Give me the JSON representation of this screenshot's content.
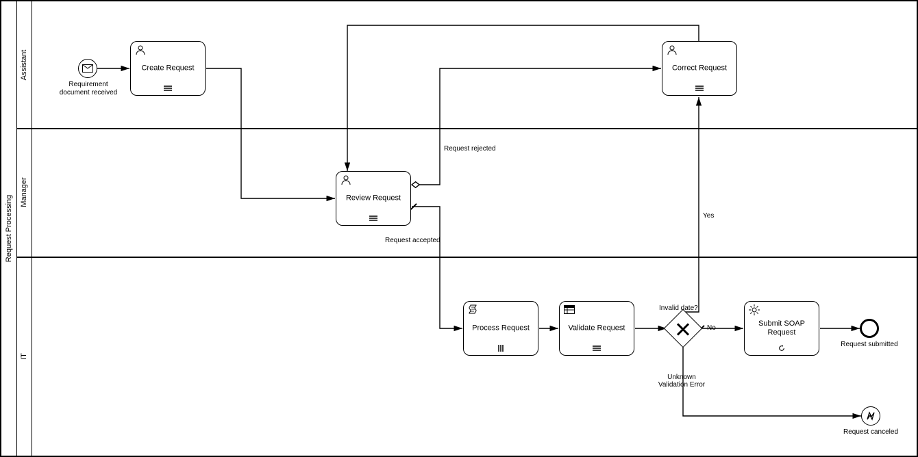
{
  "pool": {
    "title": "Request Processing"
  },
  "lanes": {
    "assistant": {
      "title": "Assistant"
    },
    "manager": {
      "title": "Manager"
    },
    "it": {
      "title": "IT"
    }
  },
  "events": {
    "start": {
      "label": "Requirement document received"
    },
    "submitted": {
      "label": "Request submitted"
    },
    "canceled": {
      "label": "Request canceled"
    }
  },
  "tasks": {
    "create": {
      "label": "Create Request"
    },
    "correct": {
      "label": "Correct Request"
    },
    "review": {
      "label": "Review Request"
    },
    "process": {
      "label": "Process Request"
    },
    "validate": {
      "label": "Validate Request"
    },
    "submit": {
      "label": "Submit SOAP Request"
    }
  },
  "gateway": {
    "invalid": {
      "label": "Invalid date?"
    }
  },
  "flows": {
    "rejected": {
      "label": "Request rejected"
    },
    "accepted": {
      "label": "Request accepted"
    },
    "yes": {
      "label": "Yes"
    },
    "no": {
      "label": "No"
    },
    "unknownErr": {
      "label": "Unknown Validation Error"
    }
  }
}
